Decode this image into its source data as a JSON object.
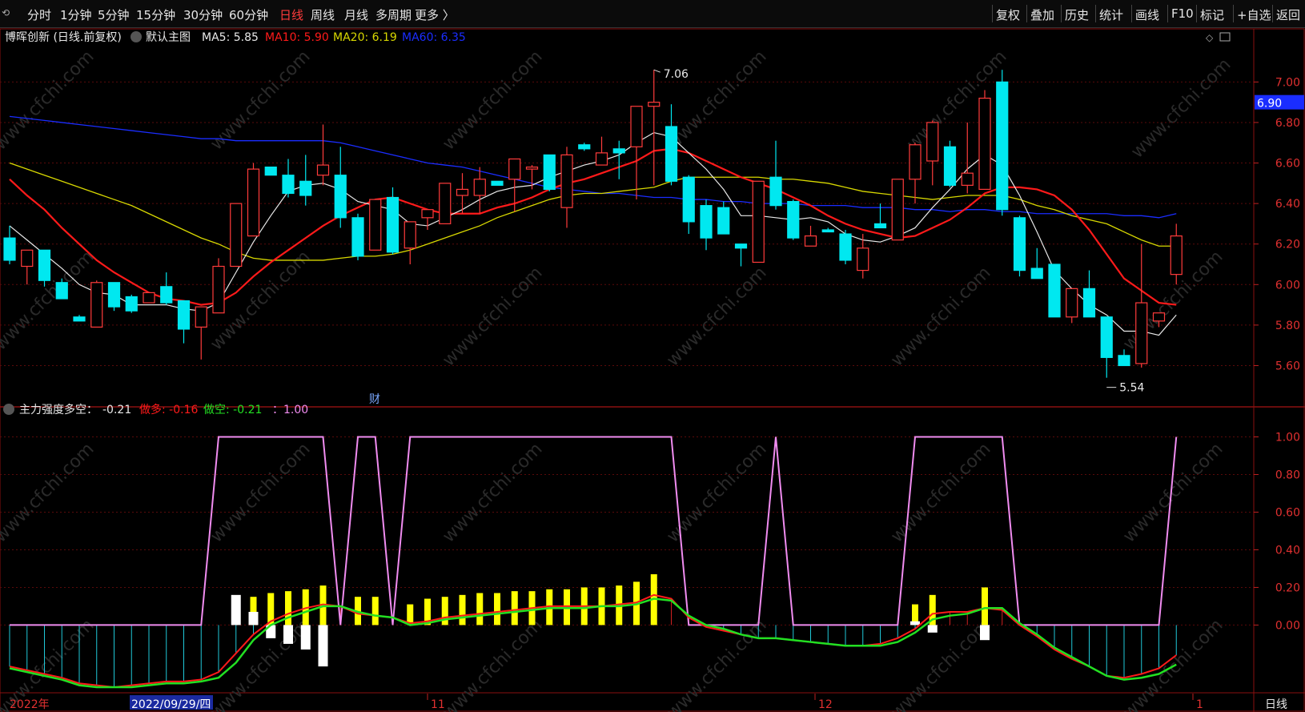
{
  "toolbar": {
    "left_tabs": [
      "分时",
      "1分钟",
      "5分钟",
      "15分钟",
      "30分钟",
      "60分钟",
      "日线",
      "周线",
      "月线",
      "多周期",
      "更多 〉"
    ],
    "active_tab": "日线",
    "right_tabs": [
      "复权",
      "叠加",
      "历史",
      "统计",
      "画线",
      "F10",
      "标记",
      "+自选",
      "返回"
    ]
  },
  "main_header": {
    "stock": "博晖创新 (日线.前复权)",
    "template": "默认主图",
    "ma5": "MA5: 5.85",
    "ma10": "MA10: 5.90",
    "ma20": "MA20: 6.19",
    "ma60": "MA60: 6.35"
  },
  "sub_header": {
    "title": "主力强度多空：",
    "value": "-0.21",
    "bull": "做多: -0.16",
    "bear": "做空: -0.21",
    "line": "：1.00"
  },
  "price_axis": [
    "7.00",
    "6.80",
    "6.60",
    "6.40",
    "6.20",
    "6.00",
    "5.80",
    "5.60"
  ],
  "indicator_axis": [
    "1.00",
    "0.80",
    "0.60",
    "0.40",
    "0.20",
    "0.00"
  ],
  "current_price": "6.90",
  "high_label": "7.06",
  "low_label": "5.54",
  "finance_marker": "财",
  "date_axis": {
    "start": "2022年",
    "selected": "2022/09/29/四",
    "m11": "11",
    "m12": "12",
    "m1": "1"
  },
  "period_label": "日线",
  "watermark": "www.cfchi.com",
  "colors": {
    "up": "#ff3b3b",
    "down": "#00e8f0",
    "ma5": "#e8e8e8",
    "ma10": "#ff1a1a",
    "ma20": "#d8d800",
    "ma60": "#1a2dff",
    "pink": "#f08cf0",
    "green": "#22e022",
    "yellow": "#ffff00"
  },
  "chart_data": {
    "type": "candlestick",
    "candles": [
      [
        6.23,
        6.29,
        6.1,
        6.12
      ],
      [
        6.09,
        6.15,
        6.0,
        6.17
      ],
      [
        6.17,
        6.17,
        5.99,
        6.02
      ],
      [
        6.01,
        6.03,
        5.93,
        5.93
      ],
      [
        5.84,
        5.85,
        5.82,
        5.82
      ],
      [
        5.79,
        6.02,
        5.79,
        6.01
      ],
      [
        6.01,
        6.01,
        5.87,
        5.89
      ],
      [
        5.94,
        5.95,
        5.86,
        5.87
      ],
      [
        5.91,
        5.96,
        5.91,
        5.96
      ],
      [
        5.99,
        6.06,
        5.9,
        5.91
      ],
      [
        5.92,
        5.92,
        5.71,
        5.78
      ],
      [
        5.79,
        5.89,
        5.63,
        5.89
      ],
      [
        5.86,
        6.13,
        5.86,
        6.09
      ],
      [
        6.09,
        6.4,
        6.09,
        6.4
      ],
      [
        6.24,
        6.6,
        6.24,
        6.57
      ],
      [
        6.58,
        6.58,
        6.54,
        6.54
      ],
      [
        6.54,
        6.62,
        6.43,
        6.45
      ],
      [
        6.51,
        6.64,
        6.39,
        6.44
      ],
      [
        6.54,
        6.79,
        6.49,
        6.59
      ],
      [
        6.54,
        6.68,
        6.28,
        6.33
      ],
      [
        6.33,
        6.35,
        6.12,
        6.14
      ],
      [
        6.17,
        6.4,
        6.17,
        6.42
      ],
      [
        6.43,
        6.48,
        6.15,
        6.16
      ],
      [
        6.18,
        6.18,
        6.1,
        6.31
      ],
      [
        6.33,
        6.36,
        6.27,
        6.37
      ],
      [
        6.3,
        6.39,
        6.3,
        6.5
      ],
      [
        6.44,
        6.55,
        6.35,
        6.47
      ],
      [
        6.44,
        6.58,
        6.35,
        6.52
      ],
      [
        6.51,
        6.51,
        6.49,
        6.49
      ],
      [
        6.52,
        6.61,
        6.36,
        6.62
      ],
      [
        6.57,
        6.59,
        6.47,
        6.58
      ],
      [
        6.64,
        6.64,
        6.46,
        6.47
      ],
      [
        6.38,
        6.68,
        6.28,
        6.64
      ],
      [
        6.69,
        6.7,
        6.66,
        6.67
      ],
      [
        6.59,
        6.73,
        6.6,
        6.65
      ],
      [
        6.67,
        6.71,
        6.52,
        6.65
      ],
      [
        6.68,
        6.79,
        6.42,
        6.88
      ],
      [
        6.88,
        7.06,
        6.49,
        6.9
      ],
      [
        6.78,
        6.89,
        6.49,
        6.51
      ],
      [
        6.53,
        6.54,
        6.25,
        6.31
      ],
      [
        6.39,
        6.42,
        6.17,
        6.23
      ],
      [
        6.38,
        6.41,
        6.27,
        6.25
      ],
      [
        6.2,
        6.2,
        6.09,
        6.18
      ],
      [
        6.11,
        6.44,
        6.11,
        6.51
      ],
      [
        6.53,
        6.71,
        6.37,
        6.39
      ],
      [
        6.41,
        6.42,
        6.22,
        6.23
      ],
      [
        6.19,
        6.29,
        6.19,
        6.24
      ],
      [
        6.27,
        6.28,
        6.26,
        6.26
      ],
      [
        6.25,
        6.27,
        6.1,
        6.12
      ],
      [
        6.07,
        6.25,
        6.03,
        6.18
      ],
      [
        6.3,
        6.4,
        6.28,
        6.28
      ],
      [
        6.22,
        6.52,
        6.23,
        6.52
      ],
      [
        6.52,
        6.7,
        6.4,
        6.69
      ],
      [
        6.61,
        6.81,
        6.49,
        6.8
      ],
      [
        6.68,
        6.71,
        6.48,
        6.49
      ],
      [
        6.49,
        6.8,
        6.45,
        6.55
      ],
      [
        6.47,
        6.96,
        6.47,
        6.92
      ],
      [
        7.0,
        7.06,
        6.34,
        6.37
      ],
      [
        6.33,
        6.34,
        6.04,
        6.07
      ],
      [
        6.08,
        6.18,
        6.05,
        6.03
      ],
      [
        6.1,
        6.1,
        5.84,
        5.84
      ],
      [
        5.84,
        5.94,
        5.81,
        5.98
      ],
      [
        5.98,
        6.07,
        5.84,
        5.84
      ],
      [
        5.84,
        5.84,
        5.54,
        5.64
      ],
      [
        5.65,
        5.68,
        5.61,
        5.6
      ],
      [
        5.61,
        6.2,
        5.59,
        5.91
      ],
      [
        5.82,
        5.84,
        5.79,
        5.86
      ],
      [
        6.05,
        6.3,
        6.0,
        6.24
      ]
    ],
    "ma5": [
      6.29,
      6.22,
      6.15,
      6.08,
      6.0,
      5.96,
      5.95,
      5.9,
      5.9,
      5.9,
      5.88,
      5.87,
      5.91,
      6.06,
      6.21,
      6.34,
      6.46,
      6.49,
      6.5,
      6.47,
      6.41,
      6.39,
      6.37,
      6.3,
      6.29,
      6.33,
      6.37,
      6.42,
      6.46,
      6.48,
      6.49,
      6.53,
      6.56,
      6.59,
      6.61,
      6.64,
      6.7,
      6.75,
      6.73,
      6.65,
      6.57,
      6.47,
      6.34,
      6.34,
      6.33,
      6.32,
      6.33,
      6.31,
      6.25,
      6.22,
      6.21,
      6.24,
      6.28,
      6.38,
      6.47,
      6.57,
      6.64,
      6.59,
      6.44,
      6.26,
      6.07,
      5.98,
      5.9,
      5.85,
      5.77,
      5.77,
      5.75,
      5.85
    ],
    "ma10": [
      6.52,
      6.44,
      6.37,
      6.28,
      6.2,
      6.12,
      6.06,
      6.01,
      5.96,
      5.93,
      5.92,
      5.9,
      5.91,
      5.96,
      6.04,
      6.11,
      6.17,
      6.23,
      6.29,
      6.34,
      6.38,
      6.42,
      6.43,
      6.4,
      6.37,
      6.35,
      6.35,
      6.35,
      6.38,
      6.4,
      6.43,
      6.47,
      6.5,
      6.52,
      6.55,
      6.58,
      6.61,
      6.66,
      6.67,
      6.65,
      6.61,
      6.57,
      6.53,
      6.5,
      6.47,
      6.43,
      6.39,
      6.34,
      6.3,
      6.27,
      6.25,
      6.23,
      6.24,
      6.28,
      6.32,
      6.38,
      6.45,
      6.48,
      6.48,
      6.47,
      6.44,
      6.37,
      6.27,
      6.15,
      6.03,
      5.97,
      5.91,
      5.9
    ],
    "ma20": [
      6.6,
      6.57,
      6.54,
      6.51,
      6.48,
      6.45,
      6.42,
      6.39,
      6.35,
      6.31,
      6.27,
      6.23,
      6.2,
      6.16,
      6.13,
      6.12,
      6.12,
      6.12,
      6.12,
      6.13,
      6.14,
      6.14,
      6.15,
      6.17,
      6.2,
      6.23,
      6.26,
      6.29,
      6.33,
      6.36,
      6.39,
      6.42,
      6.44,
      6.45,
      6.45,
      6.46,
      6.47,
      6.48,
      6.51,
      6.53,
      6.53,
      6.53,
      6.53,
      6.53,
      6.52,
      6.52,
      6.51,
      6.5,
      6.48,
      6.46,
      6.45,
      6.44,
      6.43,
      6.42,
      6.43,
      6.44,
      6.44,
      6.44,
      6.42,
      6.39,
      6.37,
      6.34,
      6.32,
      6.3,
      6.26,
      6.22,
      6.19,
      6.19
    ],
    "ma60": [
      6.83,
      6.82,
      6.81,
      6.8,
      6.79,
      6.78,
      6.77,
      6.76,
      6.75,
      6.74,
      6.73,
      6.72,
      6.72,
      6.71,
      6.71,
      6.71,
      6.71,
      6.71,
      6.71,
      6.7,
      6.68,
      6.66,
      6.64,
      6.62,
      6.6,
      6.59,
      6.58,
      6.56,
      6.54,
      6.52,
      6.5,
      6.48,
      6.47,
      6.46,
      6.45,
      6.45,
      6.44,
      6.43,
      6.43,
      6.42,
      6.42,
      6.41,
      6.41,
      6.4,
      6.4,
      6.4,
      6.39,
      6.39,
      6.39,
      6.38,
      6.38,
      6.38,
      6.37,
      6.37,
      6.36,
      6.37,
      6.37,
      6.36,
      6.36,
      6.35,
      6.35,
      6.35,
      6.35,
      6.35,
      6.34,
      6.34,
      6.33,
      6.35
    ],
    "strength": [
      0,
      0,
      0,
      0,
      0,
      0,
      0,
      0,
      0,
      0,
      0,
      0,
      1,
      1,
      1,
      1,
      1,
      1,
      1,
      0,
      1,
      1,
      0,
      1,
      1,
      1,
      1,
      1,
      1,
      1,
      1,
      1,
      1,
      1,
      1,
      1,
      1,
      1,
      1,
      0,
      0,
      0,
      0,
      0,
      1,
      0,
      0,
      0,
      0,
      0,
      0,
      0,
      1,
      1,
      1,
      1,
      1,
      1,
      0,
      0,
      0,
      0,
      0,
      0,
      0,
      0,
      0,
      1
    ],
    "bull_line": [
      -0.22,
      -0.24,
      -0.26,
      -0.28,
      -0.31,
      -0.32,
      -0.33,
      -0.32,
      -0.31,
      -0.3,
      -0.3,
      -0.29,
      -0.25,
      -0.15,
      -0.05,
      0.02,
      0.06,
      0.09,
      0.11,
      0.1,
      0.06,
      0.05,
      0.04,
      0.01,
      0.02,
      0.04,
      0.05,
      0.06,
      0.07,
      0.08,
      0.09,
      0.1,
      0.1,
      0.1,
      0.1,
      0.11,
      0.12,
      0.16,
      0.14,
      0.04,
      -0.01,
      -0.03,
      -0.05,
      -0.07,
      -0.07,
      -0.08,
      -0.09,
      -0.1,
      -0.11,
      -0.11,
      -0.1,
      -0.07,
      -0.02,
      0.06,
      0.07,
      0.07,
      0.09,
      0.08,
      0.0,
      -0.06,
      -0.13,
      -0.18,
      -0.22,
      -0.27,
      -0.28,
      -0.26,
      -0.23,
      -0.16
    ],
    "bear_line": [
      -0.23,
      -0.25,
      -0.27,
      -0.29,
      -0.32,
      -0.33,
      -0.33,
      -0.33,
      -0.32,
      -0.31,
      -0.31,
      -0.3,
      -0.28,
      -0.2,
      -0.08,
      0.0,
      0.04,
      0.07,
      0.1,
      0.1,
      0.07,
      0.05,
      0.04,
      0.0,
      0.01,
      0.03,
      0.04,
      0.05,
      0.06,
      0.07,
      0.08,
      0.09,
      0.09,
      0.09,
      0.1,
      0.1,
      0.11,
      0.14,
      0.13,
      0.05,
      0.0,
      -0.02,
      -0.05,
      -0.07,
      -0.07,
      -0.08,
      -0.09,
      -0.1,
      -0.11,
      -0.11,
      -0.11,
      -0.09,
      -0.04,
      0.03,
      0.05,
      0.06,
      0.09,
      0.09,
      0.01,
      -0.05,
      -0.12,
      -0.17,
      -0.22,
      -0.27,
      -0.29,
      -0.28,
      -0.26,
      -0.21
    ],
    "yellow_bars": [
      null,
      null,
      null,
      null,
      null,
      null,
      null,
      null,
      null,
      null,
      null,
      null,
      null,
      null,
      0.15,
      0.17,
      0.18,
      0.19,
      0.21,
      null,
      0.15,
      0.15,
      null,
      0.11,
      0.14,
      0.15,
      0.16,
      0.17,
      0.17,
      0.18,
      0.18,
      0.19,
      0.19,
      0.2,
      0.2,
      0.21,
      0.23,
      0.27,
      null,
      null,
      null,
      null,
      null,
      null,
      null,
      null,
      null,
      null,
      null,
      null,
      null,
      null,
      0.11,
      0.16,
      null,
      null,
      0.2,
      null,
      null,
      null,
      null,
      null,
      null,
      null,
      null,
      null,
      null,
      null
    ],
    "white_bars": [
      null,
      null,
      null,
      null,
      null,
      null,
      null,
      null,
      null,
      null,
      null,
      null,
      null,
      0.16,
      0.07,
      -0.07,
      -0.1,
      -0.13,
      -0.22,
      null,
      null,
      null,
      null,
      null,
      null,
      null,
      null,
      null,
      null,
      null,
      null,
      null,
      null,
      null,
      null,
      null,
      null,
      null,
      null,
      null,
      null,
      null,
      null,
      null,
      null,
      null,
      null,
      null,
      null,
      null,
      null,
      null,
      0.02,
      -0.04,
      null,
      null,
      -0.08,
      null,
      null,
      null,
      null,
      null,
      null,
      null,
      null,
      null,
      null,
      null
    ],
    "y_range": [
      5.42,
      7.12
    ],
    "indicator_range": [
      -0.36,
      1.1
    ]
  }
}
